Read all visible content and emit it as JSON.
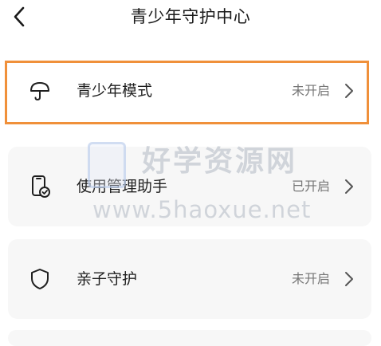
{
  "header": {
    "title": "青少年守护中心"
  },
  "rows": [
    {
      "label": "青少年模式",
      "status": "未开启",
      "icon": "umbrella-icon"
    },
    {
      "label": "使用管理助手",
      "status": "已开启",
      "icon": "phone-check-icon"
    },
    {
      "label": "亲子守护",
      "status": "未开启",
      "icon": "shield-icon"
    }
  ],
  "watermark": {
    "title": "好学资源网",
    "url": "www.5haoxue.net"
  },
  "colors": {
    "highlight": "#f0903a",
    "card_bg": "#f7f7f7",
    "status_text": "#777777"
  }
}
